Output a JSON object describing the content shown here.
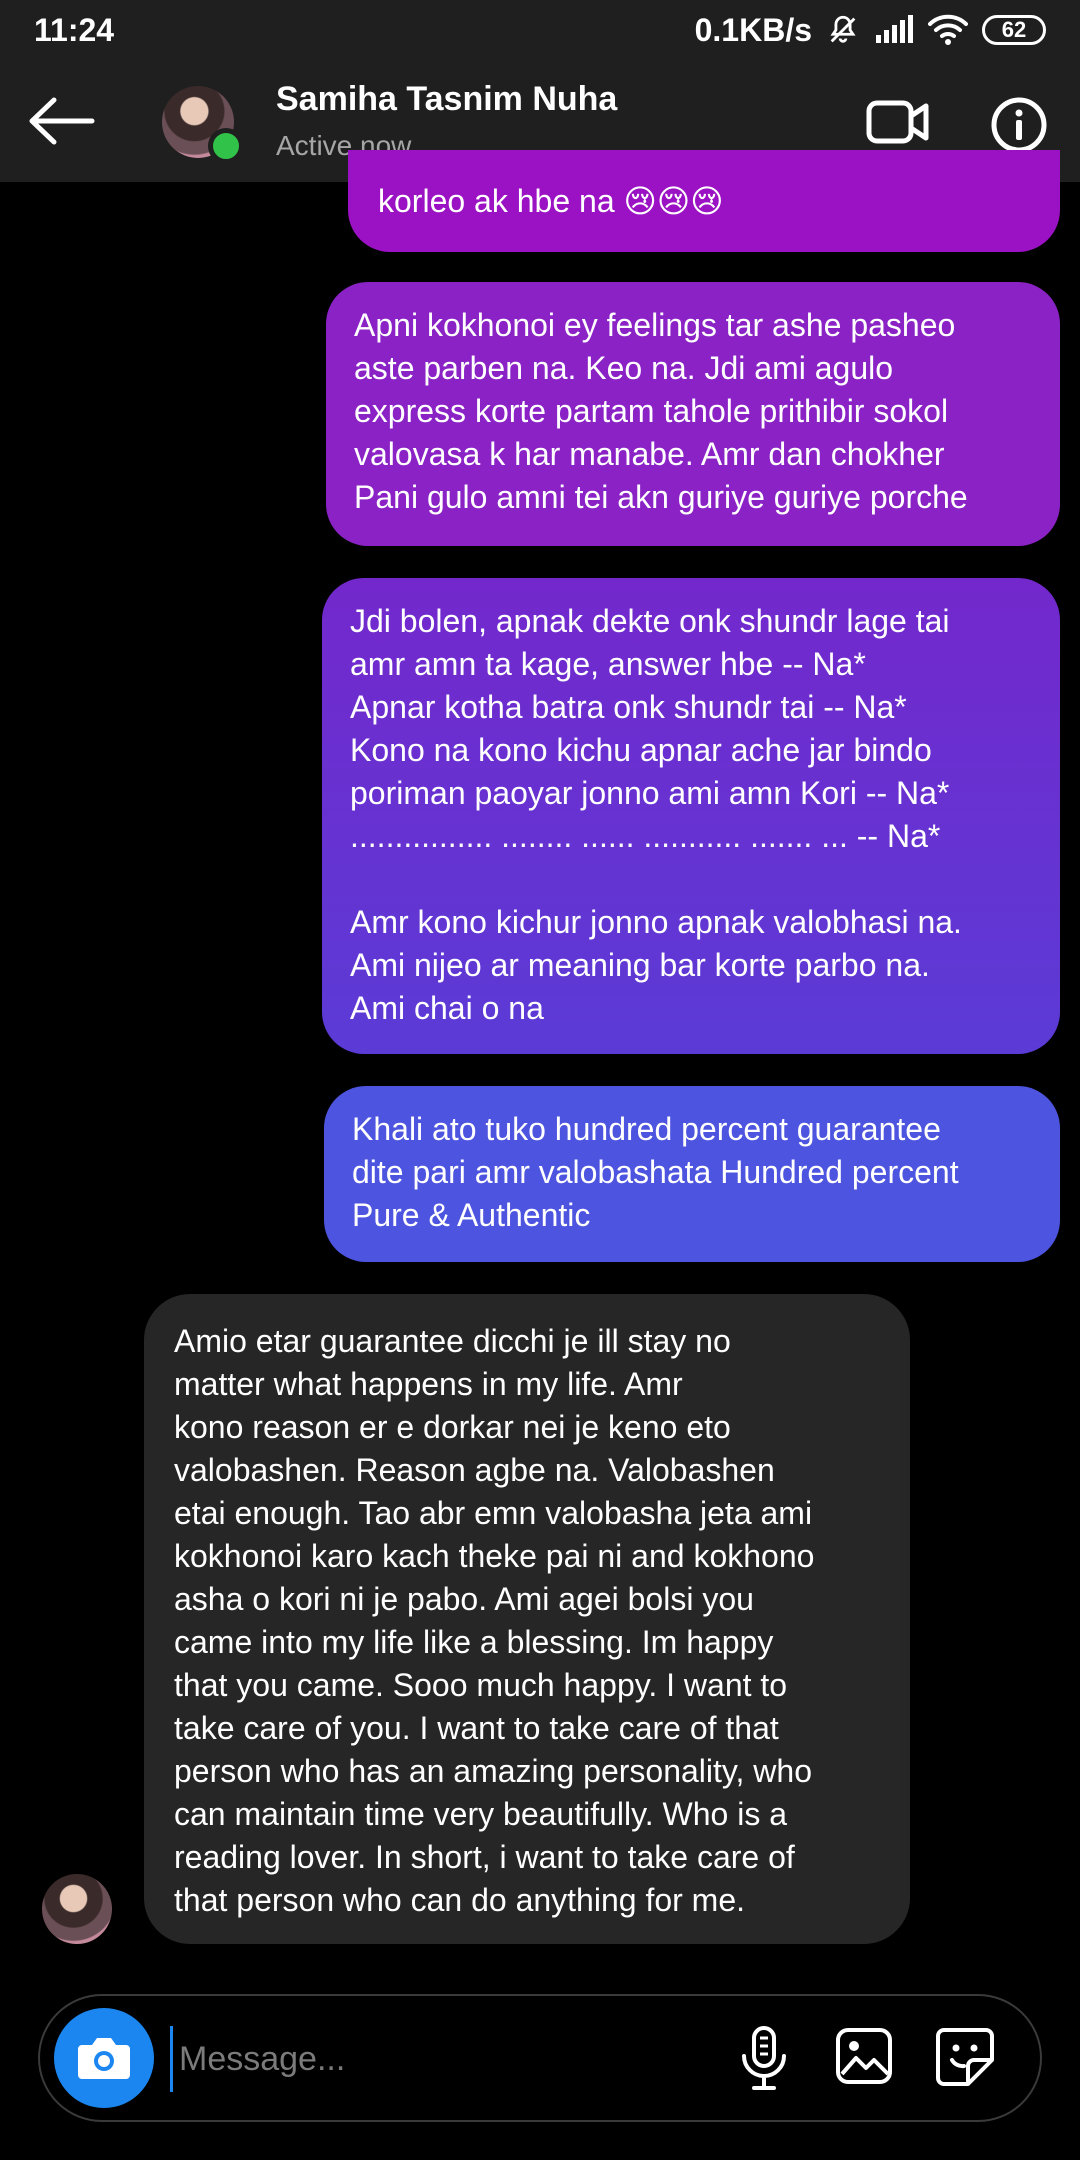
{
  "status_bar": {
    "time": "11:24",
    "network_speed": "0.1KB/s",
    "battery": "62"
  },
  "header": {
    "contact_name": "Samiha Tasnim Nuha",
    "status": "Active now"
  },
  "messages": [
    {
      "direction": "sent",
      "text": "korleo ak hbe na 😢😢😢"
    },
    {
      "direction": "sent",
      "text": "Apni kokhonoi ey feelings tar ashe pasheo\naste parben na. Keo na. Jdi ami agulo\nexpress korte partam tahole prithibir sokol\nvalovasa k har manabe. Amr dan chokher\nPani gulo amni tei akn guriye guriye porche"
    },
    {
      "direction": "sent",
      "text": "Jdi bolen, apnak dekte onk shundr lage tai\namr amn ta kage, answer hbe -- Na*\nApnar kotha batra onk shundr tai -- Na*\nKono na kono kichu apnar ache jar bindo\nporiman paoyar jonno ami amn Kori -- Na*\n................ ........  ...... ........... ....... ... -- Na*\n\nAmr kono kichur jonno apnak valobhasi na.\nAmi nijeo ar meaning bar korte parbo na.\nAmi chai o na"
    },
    {
      "direction": "sent",
      "text": "Khali ato tuko hundred percent guarantee\ndite pari amr valobashata Hundred percent\nPure & Authentic"
    },
    {
      "direction": "received",
      "text": "Amio etar guarantee dicchi je ill stay no\nmatter what happens in my life. Amr\nkono reason er e dorkar nei je keno eto\nvalobashen. Reason agbe na. Valobashen\netai enough. Tao abr emn valobasha jeta ami\nkokhonoi karo kach theke pai ni and kokhono\nasha o kori ni je pabo. Ami agei bolsi you\ncame into my life like a blessing. Im happy\nthat you came. Sooo much happy. I want to\ntake care of you. I want to take care of that\nperson who has an amazing personality, who\ncan maintain time very beautifully. Who is a\nreading lover. In short, i want to take care of\nthat person who can do anything for me."
    }
  ],
  "composer": {
    "placeholder": "Message..."
  },
  "colors": {
    "online": "#31c24a",
    "camera_button": "#1b86f0",
    "received_bubble": "#262626"
  }
}
